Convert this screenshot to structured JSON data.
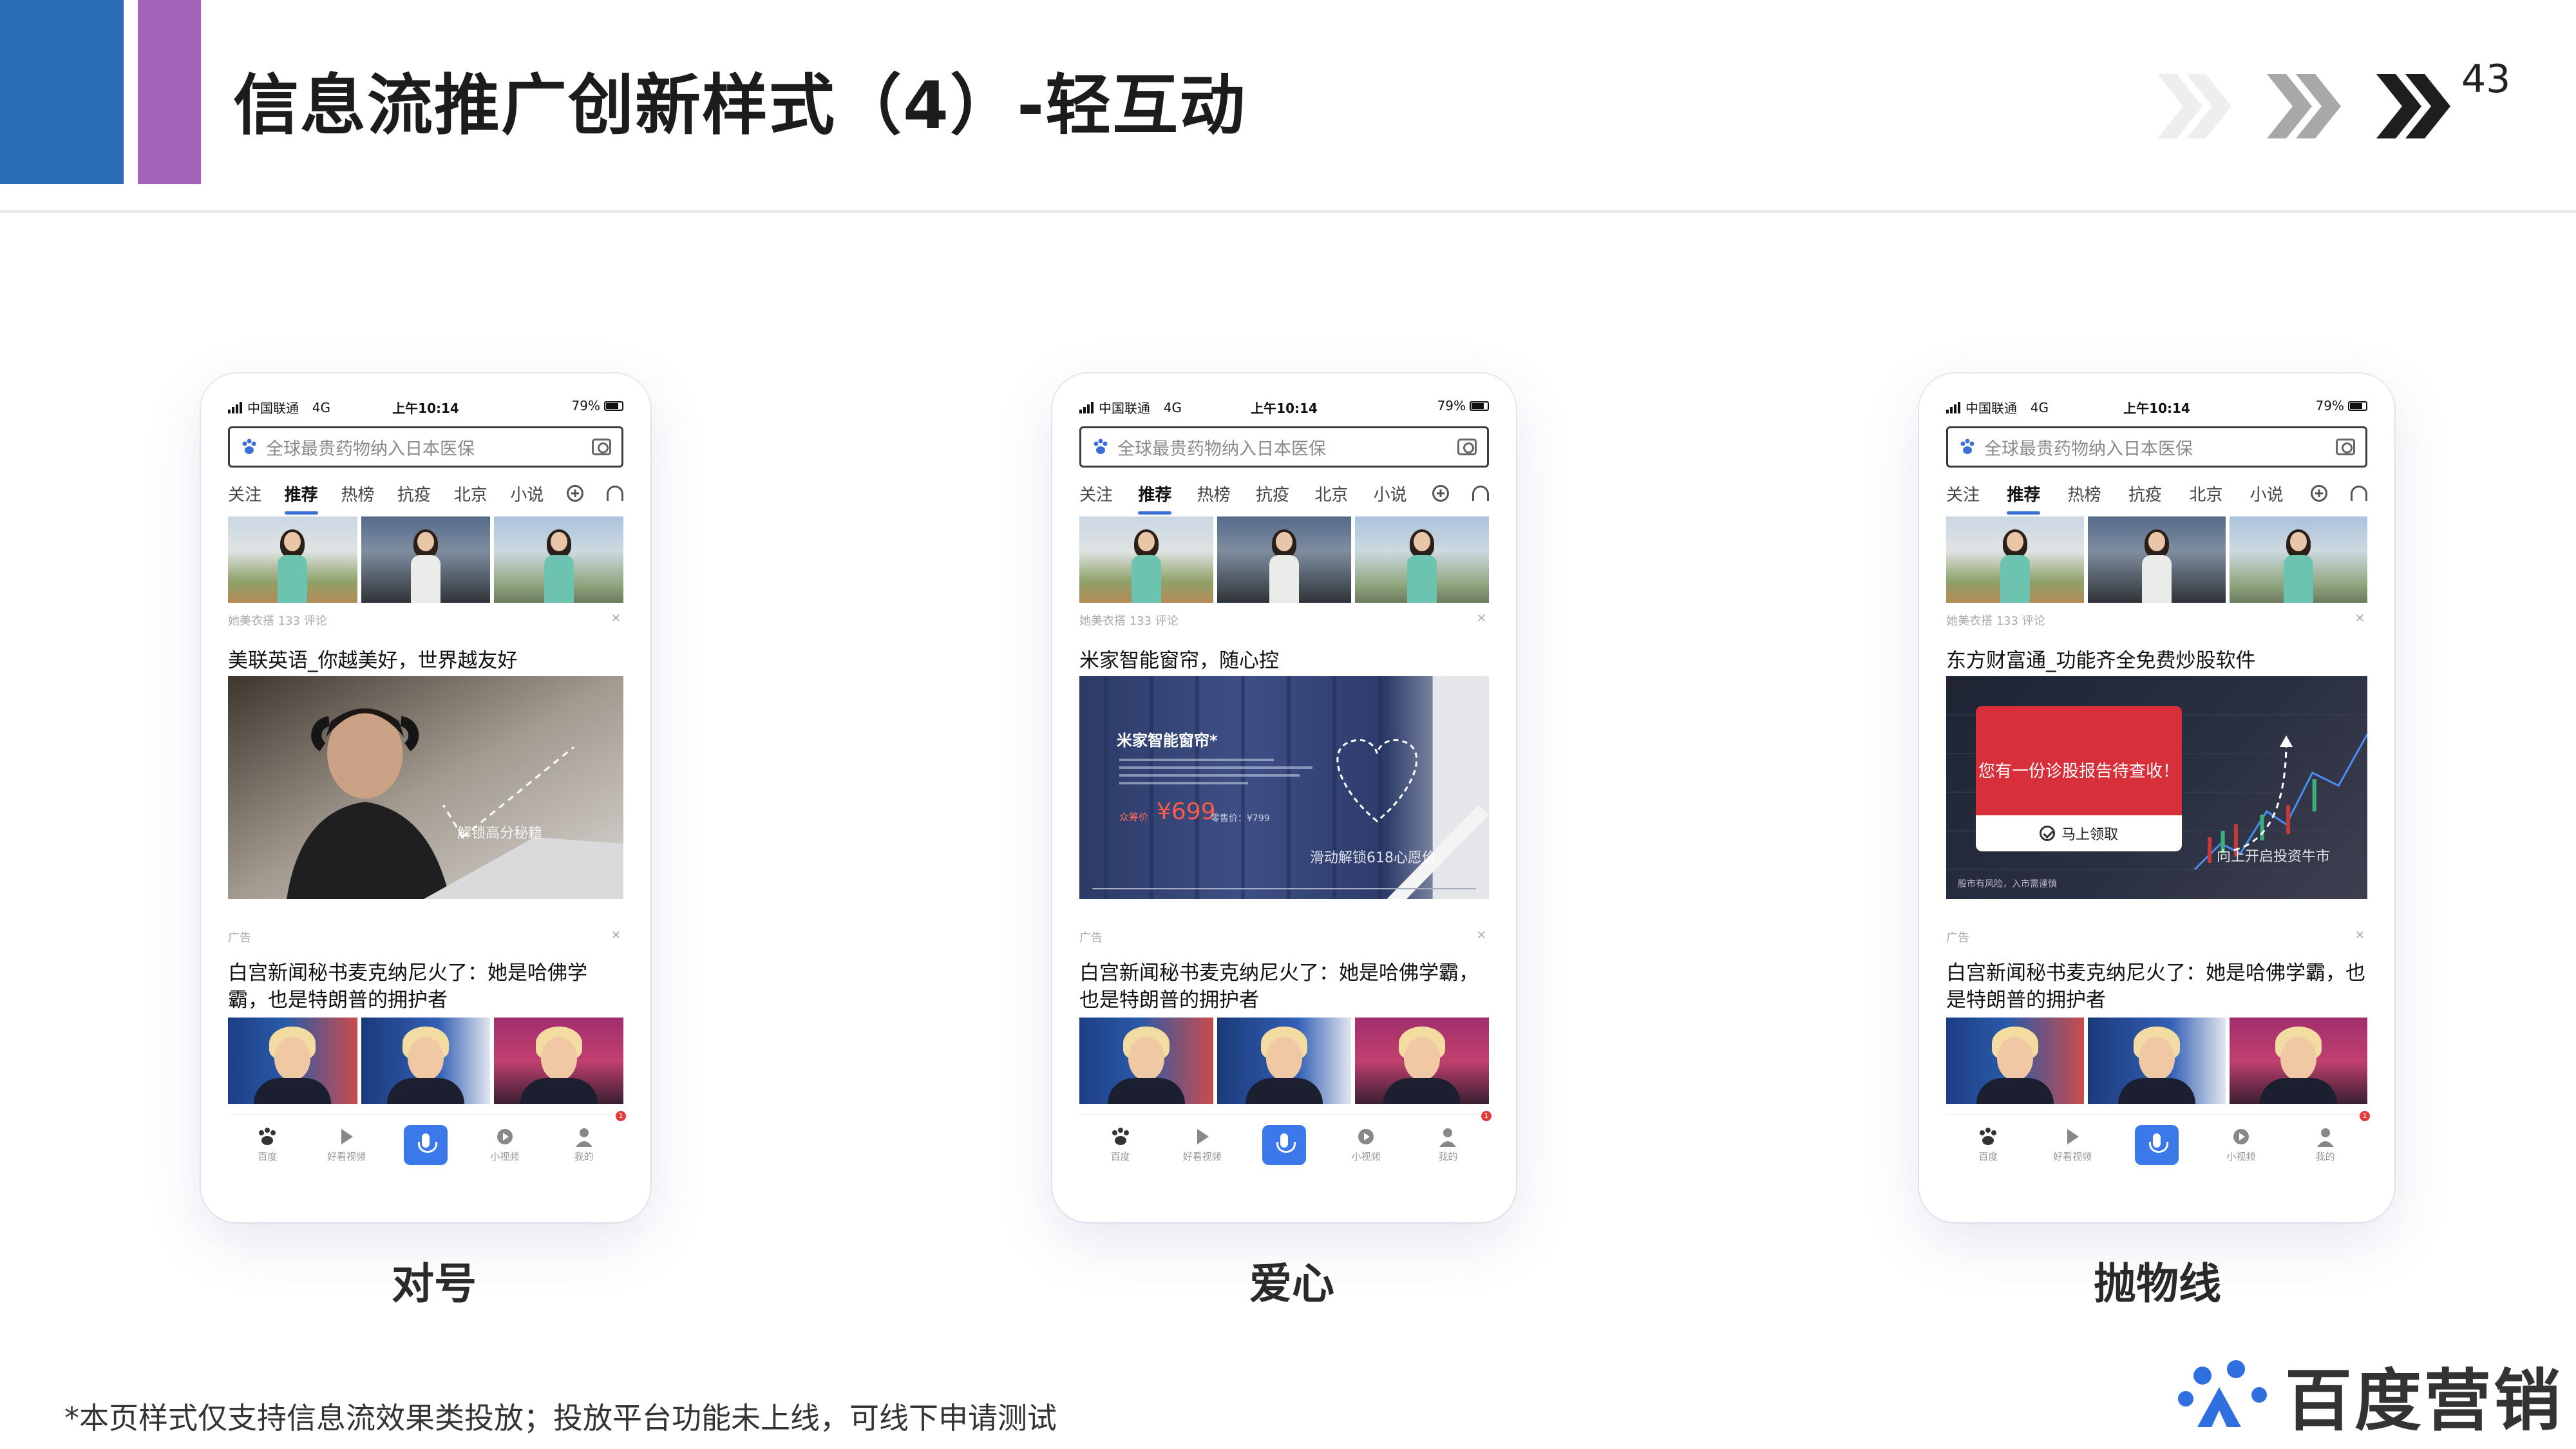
{
  "slide": {
    "title": "信息流推广创新样式（4）-轻互动",
    "page_number": "43",
    "footnote": "*本页样式仅支持信息流效果类投放；投放平台功能未上线，可线下申请测试",
    "brand": "百度营销",
    "colors": {
      "blue_bar": "#2b6db5",
      "purple_bar": "#a463b8",
      "accent": "#3b6fd8"
    }
  },
  "phones": [
    {
      "caption": "对号",
      "status": {
        "carrier": "中国联通",
        "network": "4G",
        "time": "上午10:14",
        "battery": "79%"
      },
      "search_placeholder": "全球最贵药物纳入日本医保",
      "tabs": [
        "关注",
        "推荐",
        "热榜",
        "抗疫",
        "北京",
        "小说"
      ],
      "meta": "她美衣搭  133 评论",
      "ad_title": "美联英语_你越美好，世界越友好",
      "ad_overlay": "解锁高分秘籍",
      "ad_label": "广告",
      "news_title": "白宫新闻秘书麦克纳尼火了：她是哈佛学霸，也是特朗普的拥护者",
      "nav": [
        "百度",
        "好看视频",
        "",
        "小视频",
        "我的"
      ]
    },
    {
      "caption": "爱心",
      "status": {
        "carrier": "中国联通",
        "network": "4G",
        "time": "上午10:14",
        "battery": "79%"
      },
      "search_placeholder": "全球最贵药物纳入日本医保",
      "tabs": [
        "关注",
        "推荐",
        "热榜",
        "抗疫",
        "北京",
        "小说"
      ],
      "meta": "她美衣搭  133 评论",
      "ad_title": "米家智能窗帘，随心控",
      "ad_heading": "米家智能窗帘*",
      "ad_price_label": "众筹价",
      "ad_price": "¥699",
      "ad_price_orig": "零售价：¥799",
      "ad_overlay": "滑动解锁618心愿价",
      "ad_label": "广告",
      "news_title": "白宫新闻秘书麦克纳尼火了：她是哈佛学霸，也是特朗普的拥护者",
      "nav": [
        "百度",
        "好看视频",
        "",
        "小视频",
        "我的"
      ]
    },
    {
      "caption": "抛物线",
      "status": {
        "carrier": "中国联通",
        "network": "4G",
        "time": "上午10:14",
        "battery": "79%"
      },
      "search_placeholder": "全球最贵药物纳入日本医保",
      "tabs": [
        "关注",
        "推荐",
        "热榜",
        "抗疫",
        "北京",
        "小说"
      ],
      "meta": "她美衣搭  133 评论",
      "ad_title": "东方财富通_功能齐全免费炒股软件",
      "ad_card_text": "您有一份诊股报告待查收！",
      "ad_card_button": "马上领取",
      "ad_overlay": "向上开启投资牛市",
      "ad_risk": "股市有风险，入市需谨慎",
      "ad_label": "广告",
      "news_title": "白宫新闻秘书麦克纳尼火了：她是哈佛学霸，也是特朗普的拥护者",
      "nav": [
        "百度",
        "好看视频",
        "",
        "小视频",
        "我的"
      ]
    }
  ]
}
